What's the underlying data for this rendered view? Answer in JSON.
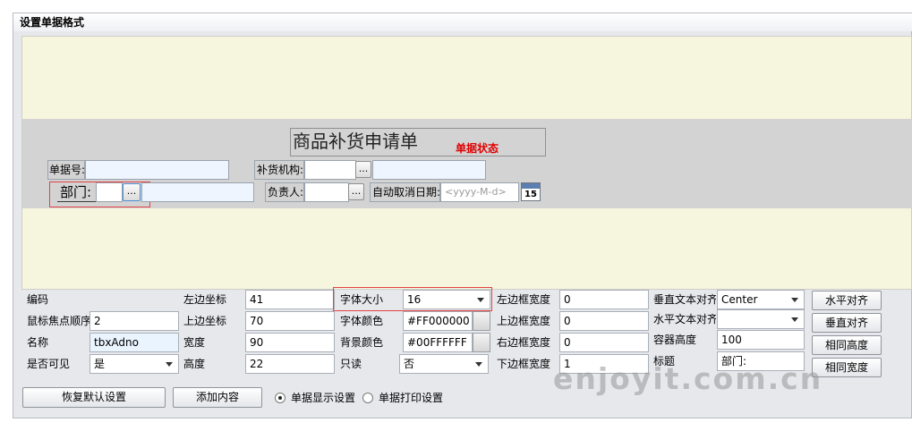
{
  "window": {
    "title": "设置单据格式"
  },
  "doc": {
    "title": "商品补货申请单",
    "status": "单据状态",
    "fields": {
      "bill_no_label": "单据号:",
      "supplier_label": "补货机构:",
      "dept_label": "部门:",
      "manager_label": "负责人:",
      "auto_cancel_label": "自动取消日期:",
      "date_placeholder": "<yyyy-M-d>",
      "calendar_day": "15",
      "ellipsis": "..."
    }
  },
  "props": {
    "code_label": "编码",
    "focus_order_label": "鼠标焦点顺序",
    "focus_order_value": "2",
    "name_label": "名称",
    "name_value": "tbxAdno",
    "visible_label": "是否可见",
    "visible_value": "是",
    "left_label": "左边坐标",
    "left_value": "41",
    "top_label": "上边坐标",
    "top_value": "70",
    "width_label": "宽度",
    "width_value": "90",
    "height_label": "高度",
    "height_value": "22",
    "font_size_label": "字体大小",
    "font_size_value": "16",
    "font_color_label": "字体颜色",
    "font_color_value": "#FF000000",
    "bg_color_label": "背景颜色",
    "bg_color_value": "#00FFFFFF",
    "readonly_label": "只读",
    "readonly_value": "否",
    "left_border_label": "左边框宽度",
    "left_border_value": "0",
    "top_border_label": "上边框宽度",
    "top_border_value": "0",
    "right_border_label": "右边框宽度",
    "right_border_value": "0",
    "bottom_border_label": "下边框宽度",
    "bottom_border_value": "1",
    "v_align_label": "垂直文本对齐",
    "v_align_value": "Center",
    "h_align_label": "水平文本对齐",
    "h_align_value": "",
    "container_height_label": "容器高度",
    "container_height_value": "100",
    "caption_label": "标题",
    "caption_value": "部门:"
  },
  "actions": {
    "h_align": "水平对齐",
    "v_align": "垂直对齐",
    "same_height": "相同高度",
    "same_width": "相同宽度",
    "restore_default": "恢复默认设置",
    "add_content": "添加内容",
    "display_setting": "单据显示设置",
    "print_setting": "单据打印设置"
  },
  "watermark": "enjoyit.com.cn",
  "colors": {
    "status_red": "#e00000",
    "canvas_bg": "#f6f5dd",
    "band_bg": "#d3d3d3",
    "highlight_red": "#e34242"
  }
}
